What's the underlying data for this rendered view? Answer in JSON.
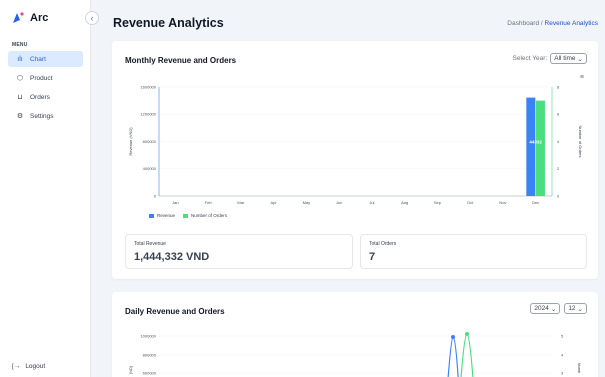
{
  "app": {
    "name": "Arc"
  },
  "sidebar": {
    "menu_label": "MENU",
    "items": [
      {
        "label": "Chart",
        "icon": "chart-icon",
        "active": true
      },
      {
        "label": "Product",
        "icon": "box-icon",
        "active": false
      },
      {
        "label": "Orders",
        "icon": "cart-icon",
        "active": false
      },
      {
        "label": "Settings",
        "icon": "gear-icon",
        "active": false
      }
    ],
    "logout_label": "Logout",
    "collapse_glyph": "‹"
  },
  "header": {
    "title": "Revenue Analytics",
    "breadcrumb": {
      "home": "Dashboard",
      "separator": " / ",
      "current": "Revenue Analytics"
    }
  },
  "monthly": {
    "title": "Monthly Revenue and Orders",
    "select_label": "Select Year:",
    "select_value": "All time",
    "menu_glyph": "≡",
    "total_revenue_label": "Total Revenue",
    "total_revenue_value": "1,444,332 VND",
    "total_orders_label": "Total Orders",
    "total_orders_value": "7"
  },
  "daily": {
    "title": "Daily Revenue and Orders",
    "year_value": "2024",
    "month_value": "12"
  },
  "colors": {
    "revenue": "#3b82f6",
    "orders": "#4ade80",
    "accent": "#2563eb"
  },
  "chart_data": [
    {
      "type": "bar",
      "categories": [
        "Jan",
        "Feb",
        "Mar",
        "Apr",
        "May",
        "Jun",
        "Jul",
        "Aug",
        "Sep",
        "Oct",
        "Nov",
        "Dec"
      ],
      "series": [
        {
          "name": "Revenue",
          "axis": "left",
          "values": [
            0,
            0,
            0,
            0,
            0,
            0,
            0,
            0,
            0,
            0,
            0,
            1444332
          ]
        },
        {
          "name": "Number of Orders",
          "axis": "right",
          "values": [
            0,
            0,
            0,
            0,
            0,
            0,
            0,
            0,
            0,
            0,
            0,
            7
          ]
        }
      ],
      "ylabel": "Revenue (VND)",
      "y2label": "Number of Orders",
      "ylim": [
        0,
        1600000
      ],
      "y_ticks": [
        "0",
        "400000",
        "800000",
        "1200000",
        "1600000"
      ],
      "y2lim": [
        0,
        8
      ],
      "y2_ticks": [
        "0",
        "2",
        "4",
        "6",
        "8"
      ],
      "data_label": "44332",
      "legend": "bottom-left"
    },
    {
      "type": "line",
      "ylabel": "(ND)",
      "y2label": "Numb",
      "y_ticks": [
        "600000",
        "800000",
        "1000000"
      ],
      "y2_ticks": [
        "3",
        "4",
        "5"
      ]
    }
  ]
}
